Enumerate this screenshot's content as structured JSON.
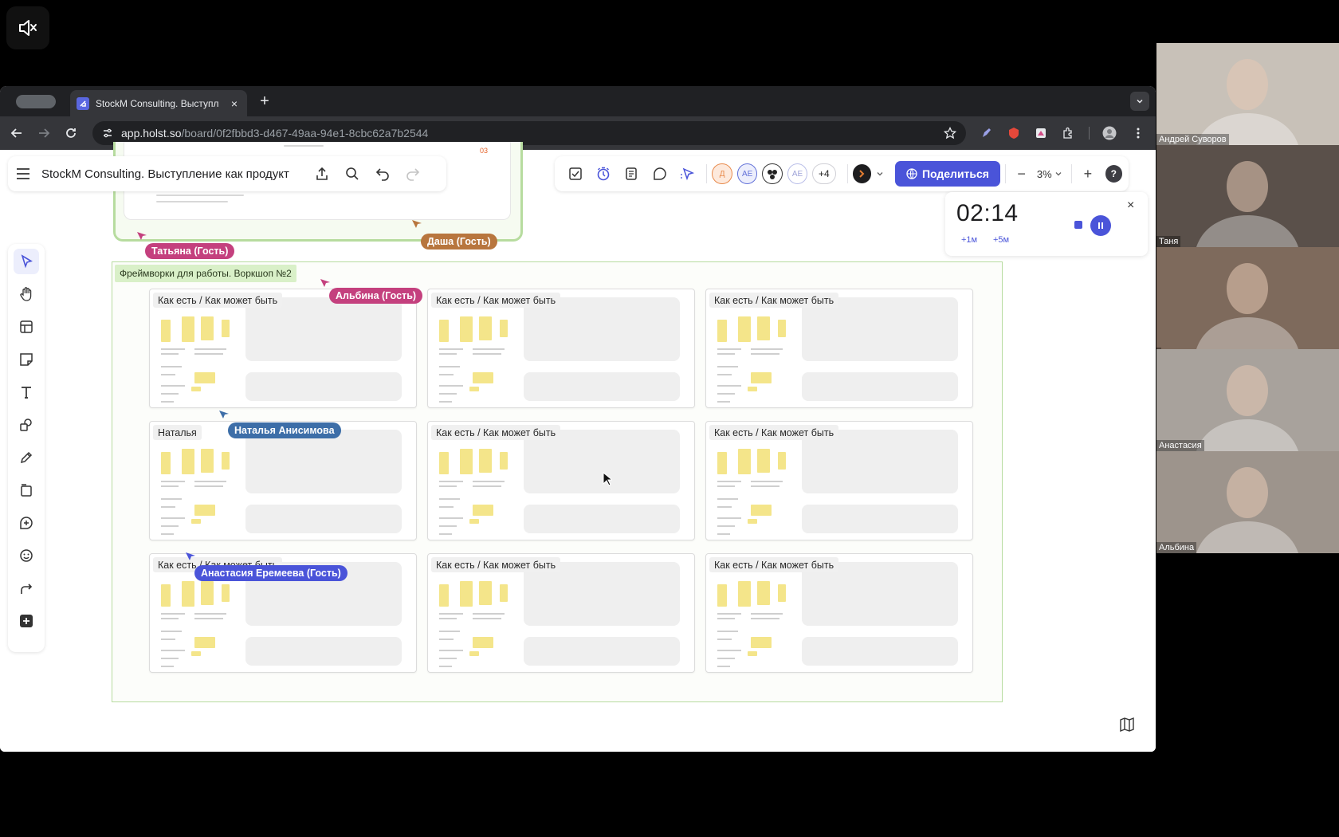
{
  "browser": {
    "tab_title": "StockM Consulting. Выступл",
    "tab_close": "×",
    "new_tab": "+",
    "url_host": "app.holst.so",
    "url_path": "/board/0f2fbbd3-d467-49aa-94e1-8cbc62a7b2544"
  },
  "header": {
    "board_title": "StockM Consulting. Выступление как продукт"
  },
  "collaborators": {
    "avatars": [
      {
        "initials": "Д",
        "color": "#e8894a"
      },
      {
        "initials": "АЕ",
        "color": "#6170d8"
      },
      {
        "initials": "",
        "color": "#333333"
      },
      {
        "initials": "АЕ",
        "color": "#b8bde8"
      }
    ],
    "more": "+4"
  },
  "share": {
    "label": "Поделиться"
  },
  "zoom": {
    "minus": "−",
    "value": "3%",
    "plus": "+"
  },
  "help": {
    "label": "?"
  },
  "timer": {
    "value": "02:14",
    "plus1": "+1м",
    "plus5": "+5м",
    "close": "×"
  },
  "frame": {
    "label": "Фреймворки для работы. Воркшоп №2"
  },
  "cards": [
    {
      "label": "Как есть  / Как может быть"
    },
    {
      "label": "Как есть  / Как может быть"
    },
    {
      "label": "Как есть  / Как может быть"
    },
    {
      "label": "Наталья"
    },
    {
      "label": "Как есть  / Как может быть"
    },
    {
      "label": "Как есть  / Как может быть"
    },
    {
      "label": "Как есть  / Как может быть"
    },
    {
      "label": "Как есть  / Как может быть"
    },
    {
      "label": "Как есть  / Как может быть"
    }
  ],
  "prev_frame": {
    "number": "03"
  },
  "cursors": [
    {
      "name": "Татьяна (Гость)",
      "color": "#c4407e"
    },
    {
      "name": "Даша (Гость)",
      "color": "#b8763e"
    },
    {
      "name": "Альбина (Гость)",
      "color": "#c4407e"
    },
    {
      "name": "Наталья Анисимова",
      "color": "#3d6ea8"
    },
    {
      "name": "Анастасия Еремеева (Гость)",
      "color": "#4a54d9"
    }
  ],
  "participants": [
    {
      "name": "Андрей Суворов",
      "bg": "#c8c1b8"
    },
    {
      "name": "Таня",
      "bg": "#5a504a"
    },
    {
      "name": "",
      "bg": "#7e6a5c"
    },
    {
      "name": "Анастасия",
      "bg": "#a8a29c"
    },
    {
      "name": "Альбина",
      "bg": "#9d948c"
    }
  ]
}
